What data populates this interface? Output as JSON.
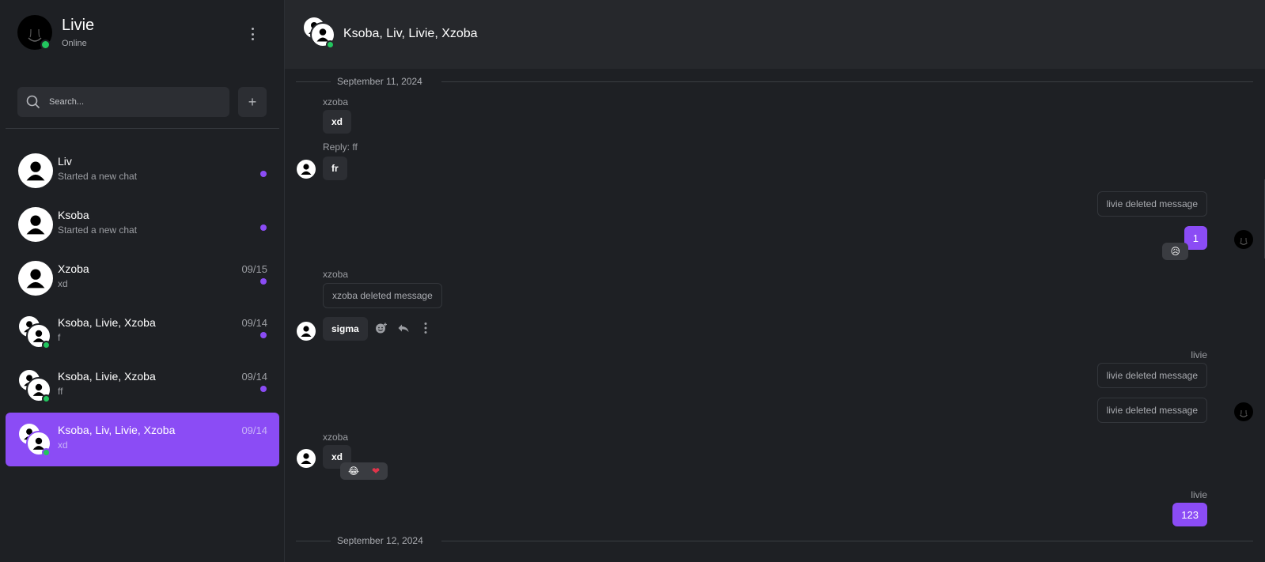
{
  "profile": {
    "name": "Livie",
    "status": "Online"
  },
  "search": {
    "placeholder": "Search...",
    "add_label": "+"
  },
  "chats": [
    {
      "name": "Liv",
      "preview": "Started a new chat",
      "date": "",
      "unread": true,
      "group": false,
      "online": false,
      "active": false
    },
    {
      "name": "Ksoba",
      "preview": "Started a new chat",
      "date": "",
      "unread": true,
      "group": false,
      "online": false,
      "active": false
    },
    {
      "name": "Xzoba",
      "preview": "xd",
      "date": "09/15",
      "unread": true,
      "group": false,
      "online": false,
      "active": false
    },
    {
      "name": "Ksoba, Livie, Xzoba",
      "preview": "f",
      "date": "09/14",
      "unread": true,
      "group": true,
      "online": true,
      "active": false
    },
    {
      "name": "Ksoba, Livie, Xzoba",
      "preview": "ff",
      "date": "09/14",
      "unread": true,
      "group": true,
      "online": true,
      "active": false
    },
    {
      "name": "Ksoba, Liv, Livie, Xzoba",
      "preview": "xd",
      "date": "09/14",
      "unread": false,
      "group": true,
      "online": true,
      "active": true
    }
  ],
  "header": {
    "title": "Ksoba, Liv, Livie, Xzoba"
  },
  "messages": {
    "date_1": "September 11, 2024",
    "date_2": "September 12, 2024",
    "m1_sender": "xzoba",
    "m1_text": "xd",
    "m2_reply": "Reply: ff",
    "m2_text": "fr",
    "m3_text": "livie deleted message",
    "m4_text": "1",
    "m4_reaction": "😥",
    "m5_sender": "xzoba",
    "m5_text": "xzoba deleted message",
    "m6_text": "sigma",
    "m7_sender": "livie",
    "m7_text": "livie deleted message",
    "m8_text": "livie deleted message",
    "m9_sender": "xzoba",
    "m9_text": "xd",
    "m9_reaction_1": "😂",
    "m9_reaction_2": "❤",
    "m10_sender": "livie",
    "m10_text": "123"
  },
  "colors": {
    "accent": "#8b4cf5",
    "online": "#22c55e",
    "background": "#1e2024",
    "header": "#26282c",
    "bubble": "#2c2e33"
  },
  "icons": {
    "menu": "kebab-menu-icon",
    "search": "search-icon",
    "user": "user-icon",
    "emoji": "add-reaction-icon",
    "reply": "reply-icon",
    "more": "more-vertical-icon"
  }
}
